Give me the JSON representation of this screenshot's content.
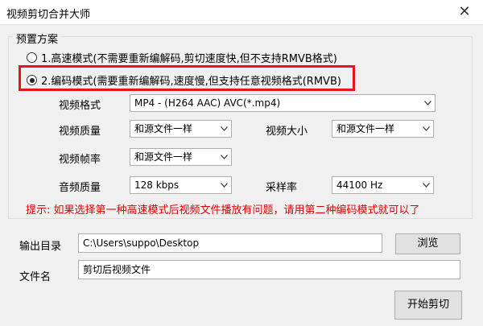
{
  "window": {
    "title": "视频剪切合并大师",
    "close_glyph": "✕"
  },
  "preset": {
    "legend": "预置方案",
    "options": [
      {
        "label": "1.高速模式(不需要重新编解码,剪切速度快,但不支持RMVB格式)",
        "checked": false
      },
      {
        "label": "2.编码模式(需要重新编解码,速度慢,但支持任意视频格式(RMVB)",
        "checked": true
      }
    ],
    "highlight_color": "#e8141b"
  },
  "settings": {
    "video_format": {
      "label": "视频格式",
      "value": "MP4 - (H264 AAC) AVC(*.mp4)"
    },
    "video_quality": {
      "label": "视频质量",
      "value": "和源文件一样"
    },
    "video_size": {
      "label": "视频大小",
      "value": "和源文件一样"
    },
    "video_fps": {
      "label": "视频帧率",
      "value": "和源文件一样"
    },
    "audio_quality": {
      "label": "音频质量",
      "value": "128 kbps"
    },
    "sample_rate": {
      "label": "采样率",
      "value": "44100 Hz"
    }
  },
  "hint": {
    "text": "提示: 如果选择第一种高速模式后视频文件播放有问题，请用第二种编码模式就可以了",
    "color": "#e00000"
  },
  "output": {
    "dir_label": "输出目录",
    "dir_value": "C:\\Users\\suppo\\Desktop",
    "browse_label": "浏览",
    "file_label": "文件名",
    "file_value": "剪切后视频文件"
  },
  "actions": {
    "start_label": "开始剪切"
  },
  "icons": {
    "dropdown": "chevron-down-icon",
    "close": "close-icon"
  }
}
